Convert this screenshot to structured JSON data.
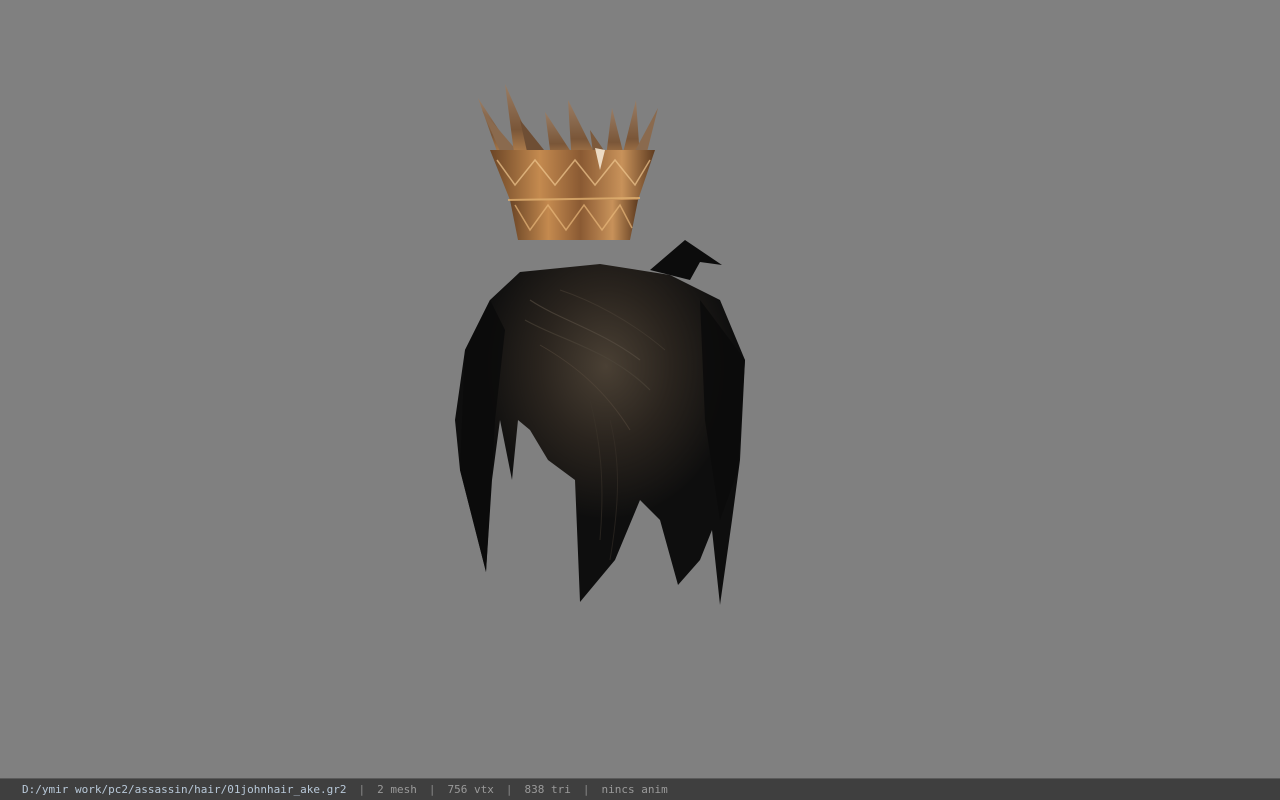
{
  "viewer": {
    "background_color": "#808080"
  },
  "scene": {
    "objects": [
      {
        "name": "crown",
        "material_color": "#a06a3a"
      },
      {
        "name": "hair",
        "material_color": "#121212"
      }
    ]
  },
  "statusbar": {
    "file_path": "D:/ymir work/pc2/assassin/hair/01johnhair_ake.gr2",
    "separator": "|",
    "mesh_count": "2 mesh",
    "vertex_count": "756 vtx",
    "triangle_count": "838 tri",
    "anim_status": "nincs anim"
  }
}
